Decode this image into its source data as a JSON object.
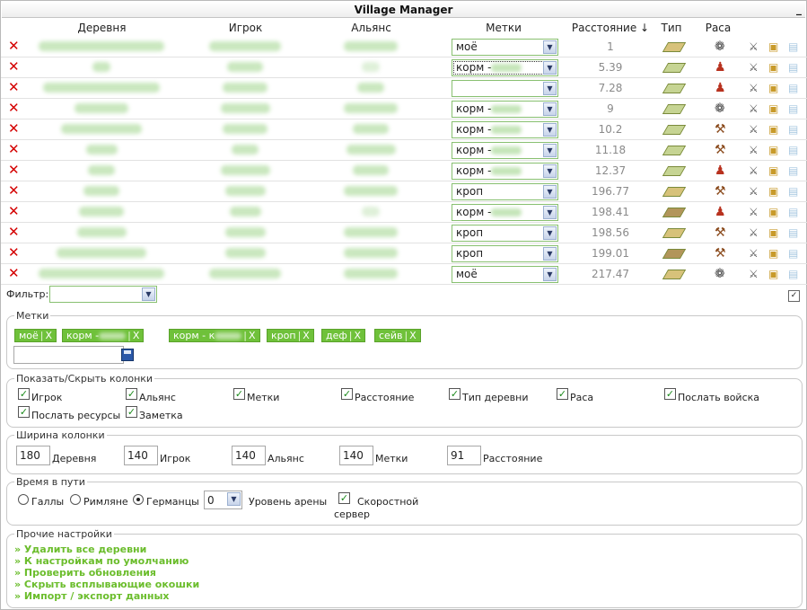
{
  "window": {
    "title": "Village Manager",
    "minimize": "_"
  },
  "columns": {
    "village": "Деревня",
    "player": "Игрок",
    "alliance": "Альянс",
    "tags": "Метки",
    "distance": "Расстояние ↓",
    "type": "Тип",
    "race": "Раса"
  },
  "rows": [
    {
      "tag": "моё",
      "tag_blur": false,
      "distance": "1",
      "race": "gaul"
    },
    {
      "tag": "корм -",
      "tag_blur": true,
      "distance": "5.39",
      "race": "roman",
      "focused": true
    },
    {
      "tag": "",
      "tag_blur": false,
      "distance": "7.28",
      "race": "roman"
    },
    {
      "tag": "корм -",
      "tag_blur": true,
      "distance": "9",
      "race": "gaul"
    },
    {
      "tag": "корм -",
      "tag_blur": true,
      "distance": "10.2",
      "race": "teuton"
    },
    {
      "tag": "корм -",
      "tag_blur": true,
      "distance": "11.18",
      "race": "teuton"
    },
    {
      "tag": "корм -",
      "tag_blur": true,
      "distance": "12.37",
      "race": "roman"
    },
    {
      "tag": "кроп",
      "tag_blur": false,
      "distance": "196.77",
      "race": "teuton"
    },
    {
      "tag": "корм -",
      "tag_blur": true,
      "distance": "198.41",
      "race": "roman"
    },
    {
      "tag": "кроп",
      "tag_blur": false,
      "distance": "198.56",
      "race": "teuton"
    },
    {
      "tag": "кроп",
      "tag_blur": false,
      "distance": "199.01",
      "race": "teuton"
    },
    {
      "tag": "моё",
      "tag_blur": false,
      "distance": "217.47",
      "race": "gaul"
    }
  ],
  "filter": {
    "label": "Фильтр:",
    "value": ""
  },
  "tags_section": {
    "legend": "Метки",
    "tags": [
      {
        "text": "моё",
        "blur": false
      },
      {
        "text": "корм -",
        "blur": true
      },
      {
        "text": "корм - к",
        "blur": true
      },
      {
        "text": "кроп",
        "blur": false
      },
      {
        "text": "деф",
        "blur": false
      },
      {
        "text": "сейв",
        "blur": false
      }
    ],
    "remove_glyph": "X",
    "new_tag_value": ""
  },
  "columns_section": {
    "legend": "Показать/Скрыть колонки",
    "options": [
      {
        "label": "Игрок",
        "checked": true
      },
      {
        "label": "Альянс",
        "checked": true
      },
      {
        "label": "Метки",
        "checked": true
      },
      {
        "label": "Расстояние",
        "checked": true
      },
      {
        "label": "Тип деревни",
        "checked": true
      },
      {
        "label": "Раса",
        "checked": true
      },
      {
        "label": "Послать войска",
        "checked": true
      },
      {
        "label": "Послать ресурсы",
        "checked": true
      },
      {
        "label": "Заметка",
        "checked": true
      }
    ]
  },
  "width_section": {
    "legend": "Ширина колонки",
    "fields": [
      {
        "value": "180",
        "label": "Деревня"
      },
      {
        "value": "140",
        "label": "Игрок"
      },
      {
        "value": "140",
        "label": "Альянс"
      },
      {
        "value": "140",
        "label": "Метки"
      },
      {
        "value": "91",
        "label": "Расстояние"
      }
    ]
  },
  "travel_section": {
    "legend": "Время в пути",
    "races": [
      {
        "label": "Галлы",
        "selected": false
      },
      {
        "label": "Римляне",
        "selected": false
      },
      {
        "label": "Германцы",
        "selected": true
      }
    ],
    "arena_value": "0",
    "arena_label": "Уровень арены",
    "fast_server_label_1": "Скоростной",
    "fast_server_label_2": "сервер",
    "fast_server_checked": true
  },
  "other_section": {
    "legend": "Прочие настройки",
    "links": [
      "» Удалить все деревни",
      "» К настройкам по умолчанию",
      "» Проверить обновления",
      "» Скрыть всплывающие окошки",
      "» Импорт / экспорт данных"
    ]
  },
  "colors": {
    "accent_green": "#6fc13a",
    "link_green": "#6bbd2c",
    "delete_red": "#d40000"
  }
}
